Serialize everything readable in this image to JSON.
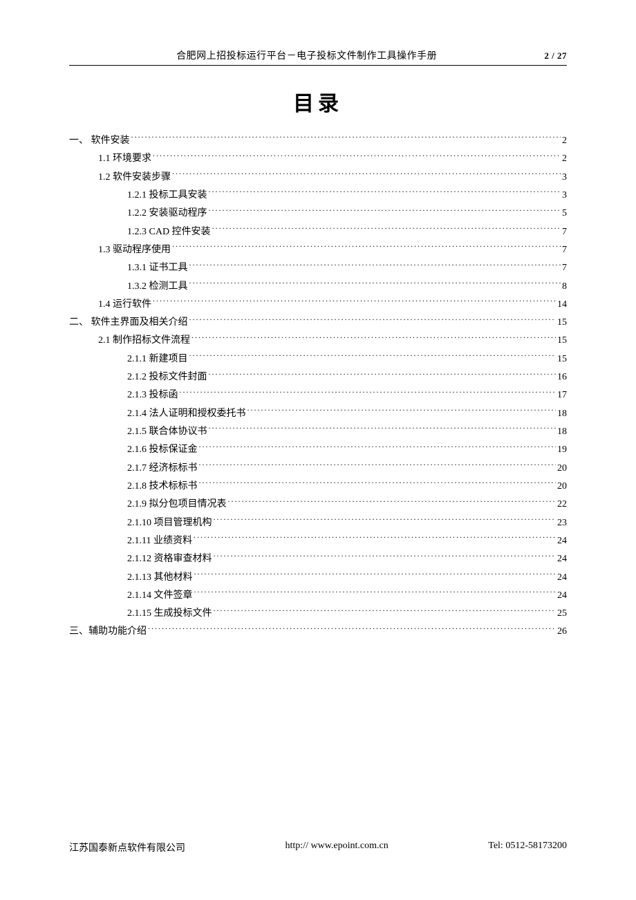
{
  "header": {
    "title": "合肥网上招投标运行平台－电子投标文件制作工具操作手册",
    "page_current": "2",
    "page_separator": " / ",
    "page_total": "27"
  },
  "toc_title": "目录",
  "toc": [
    {
      "level": 0,
      "label": "一、  软件安装",
      "page": "2"
    },
    {
      "level": 1,
      "label": "1.1  环境要求",
      "page": "2"
    },
    {
      "level": 1,
      "label": "1.2 软件安装步骤",
      "page": "3"
    },
    {
      "level": 2,
      "label": "1.2.1 投标工具安装",
      "page": "3"
    },
    {
      "level": 2,
      "label": "1.2.2 安装驱动程序",
      "page": "5"
    },
    {
      "level": 2,
      "label": "1.2.3 CAD 控件安装",
      "page": "7"
    },
    {
      "level": 1,
      "label": "1.3  驱动程序使用",
      "page": "7"
    },
    {
      "level": 2,
      "label": "1.3.1 证书工具",
      "page": "7"
    },
    {
      "level": 2,
      "label": "1.3.2 检测工具",
      "page": "8"
    },
    {
      "level": 1,
      "label": "1.4 运行软件",
      "page": "14"
    },
    {
      "level": 0,
      "label": "二、  软件主界面及相关介绍",
      "page": "15"
    },
    {
      "level": 1,
      "label": "2.1 制作招标文件流程",
      "page": "15"
    },
    {
      "level": 2,
      "label": "2.1.1  新建项目",
      "page": "15"
    },
    {
      "level": 2,
      "label": "2.1.2  投标文件封面",
      "page": "16"
    },
    {
      "level": 2,
      "label": "2.1.3  投标函",
      "page": "17"
    },
    {
      "level": 2,
      "label": "2.1.4 法人证明和授权委托书",
      "page": "18"
    },
    {
      "level": 2,
      "label": "2.1.5 联合体协议书",
      "page": "18"
    },
    {
      "level": 2,
      "label": "2.1.6  投标保证金",
      "page": "19"
    },
    {
      "level": 2,
      "label": "2.1.7 经济标标书",
      "page": "20"
    },
    {
      "level": 2,
      "label": "2.1.8 技术标标书",
      "page": "20"
    },
    {
      "level": 2,
      "label": "2.1.9 拟分包项目情况表",
      "page": "22"
    },
    {
      "level": 2,
      "label": "2.1.10  项目管理机构",
      "page": "23"
    },
    {
      "level": 2,
      "label": "2.1.11  业绩资料",
      "page": "24"
    },
    {
      "level": 2,
      "label": "2.1.12  资格审查材料",
      "page": "24"
    },
    {
      "level": 2,
      "label": "2.1.13  其他材料",
      "page": "24"
    },
    {
      "level": 2,
      "label": "2.1.14  文件签章",
      "page": "24"
    },
    {
      "level": 2,
      "label": "2.1.15  生成投标文件",
      "page": "25"
    },
    {
      "level": 0,
      "label": "三、辅助功能介绍",
      "page": "26"
    }
  ],
  "footer": {
    "company": "江苏国泰新点软件有限公司",
    "url": "http:// www.epoint.com.cn",
    "tel": "Tel: 0512-58173200"
  }
}
